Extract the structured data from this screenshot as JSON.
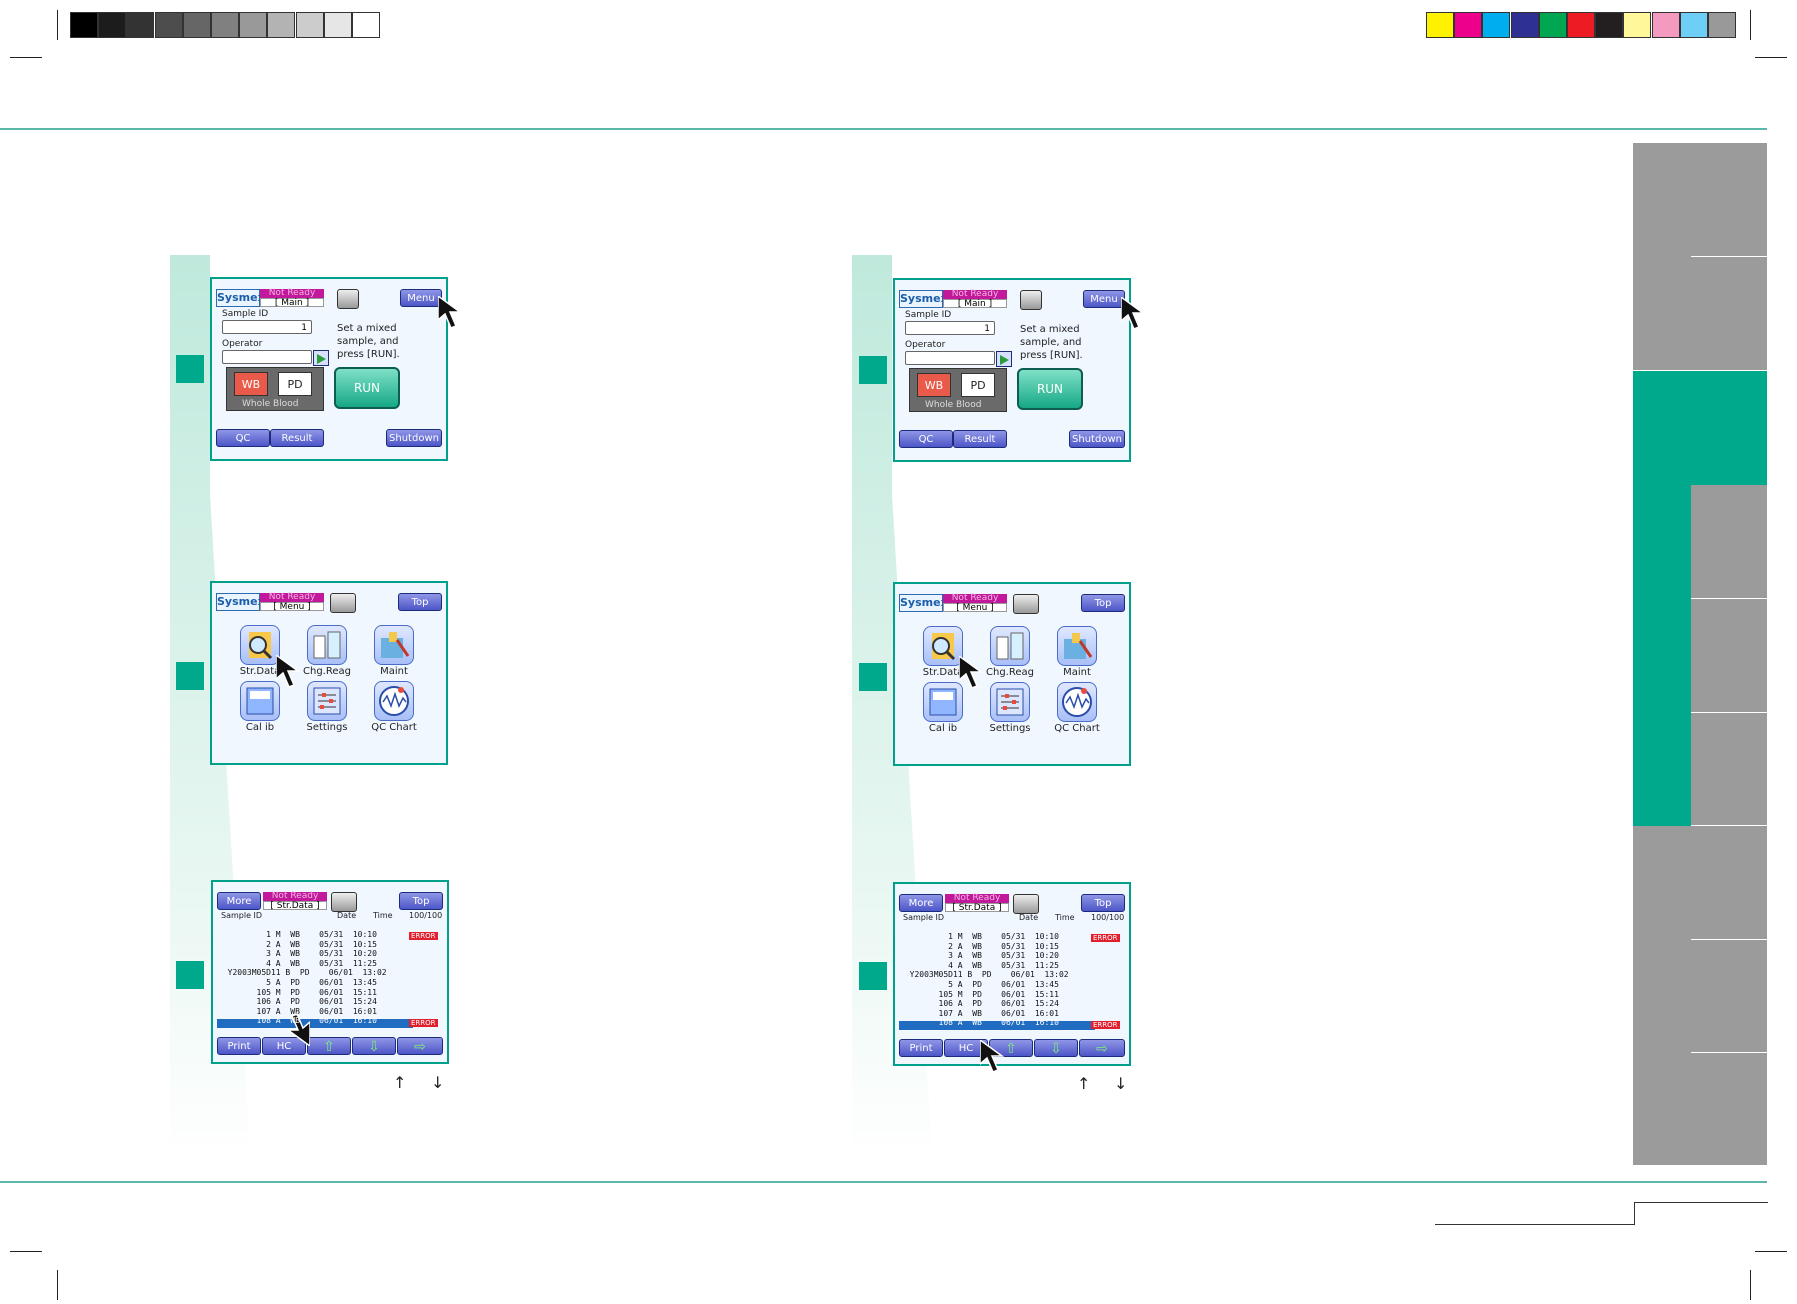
{
  "grayscale_bar": [
    "#000000",
    "#1c1c1c",
    "#333333",
    "#4d4d4d",
    "#666666",
    "#808080",
    "#999999",
    "#b3b3b3",
    "#cccccc",
    "#e6e6e6",
    "#ffffff"
  ],
  "color_bar": [
    "#fff200",
    "#ec008c",
    "#00aeef",
    "#2e3192",
    "#00a651",
    "#ed1c24",
    "#231f20",
    "#fff799",
    "#f49ac1",
    "#6dcff6",
    "#999999"
  ],
  "colors": {
    "teal": "#00a88c",
    "status_magenta": "#c2189b",
    "button_blue": "#4d56c8",
    "error_red": "#e2202d",
    "tab_gray": "#9b9b9b"
  },
  "screens": {
    "main": {
      "logo": "Sysmex",
      "status": "Not Ready",
      "mode": "[  Main  ]",
      "menu_button": "Menu",
      "sample_id_label": "Sample ID",
      "sample_id_value": "1",
      "operator_label": "Operator",
      "instruction_1": "Set a mixed",
      "instruction_2": "sample, and",
      "instruction_3": "press [RUN].",
      "wb_button": "WB",
      "pd_button": "PD",
      "blood_mode": "Whole Blood",
      "run_button": "RUN",
      "qc_button": "QC",
      "result_button": "Result",
      "shutdown_button": "Shutdown"
    },
    "menu": {
      "logo": "Sysmex",
      "status": "Not Ready",
      "mode": "[  Menu  ]",
      "top_button": "Top",
      "items": [
        {
          "label": "Str.Data",
          "icon": "magnifier-folder-icon"
        },
        {
          "label": "Chg.Reag",
          "icon": "reagent-bottles-icon"
        },
        {
          "label": "Maint",
          "icon": "maintenance-tools-icon"
        },
        {
          "label": "Cal ib",
          "icon": "calibration-icon"
        },
        {
          "label": "Settings",
          "icon": "settings-sliders-icon"
        },
        {
          "label": "QC Chart",
          "icon": "qc-chart-icon"
        }
      ]
    },
    "strdata": {
      "more_button": "More",
      "status": "Not Ready",
      "mode": "[  Str.Data  ]",
      "top_button": "Top",
      "header_sample": "Sample ID",
      "header_date": "Date",
      "header_time": "Time",
      "header_count": "100/100",
      "rows": [
        "          1 M  WB    05/31  10:10",
        "          2 A  WB    05/31  10:15",
        "          3 A  WB    05/31  10:20",
        "          4 A  WB    05/31  11:25",
        "  Y2003M05D11 B  PD    06/01  13:02",
        "          5 A  PD    06/01  13:45",
        "        105 M  PD    06/01  15:11",
        "        106 A  PD    06/01  15:24",
        "        107 A  WB    06/01  16:01",
        "        108 A  WB    06/01  16:10"
      ],
      "error_label": "ERROR",
      "print_button": "Print",
      "hc_button": "HC",
      "up_arrow": "⇧",
      "down_arrow": "⇩",
      "right_arrow": "⇨"
    }
  },
  "page_arrows": {
    "up": "↑",
    "down": "↓"
  }
}
